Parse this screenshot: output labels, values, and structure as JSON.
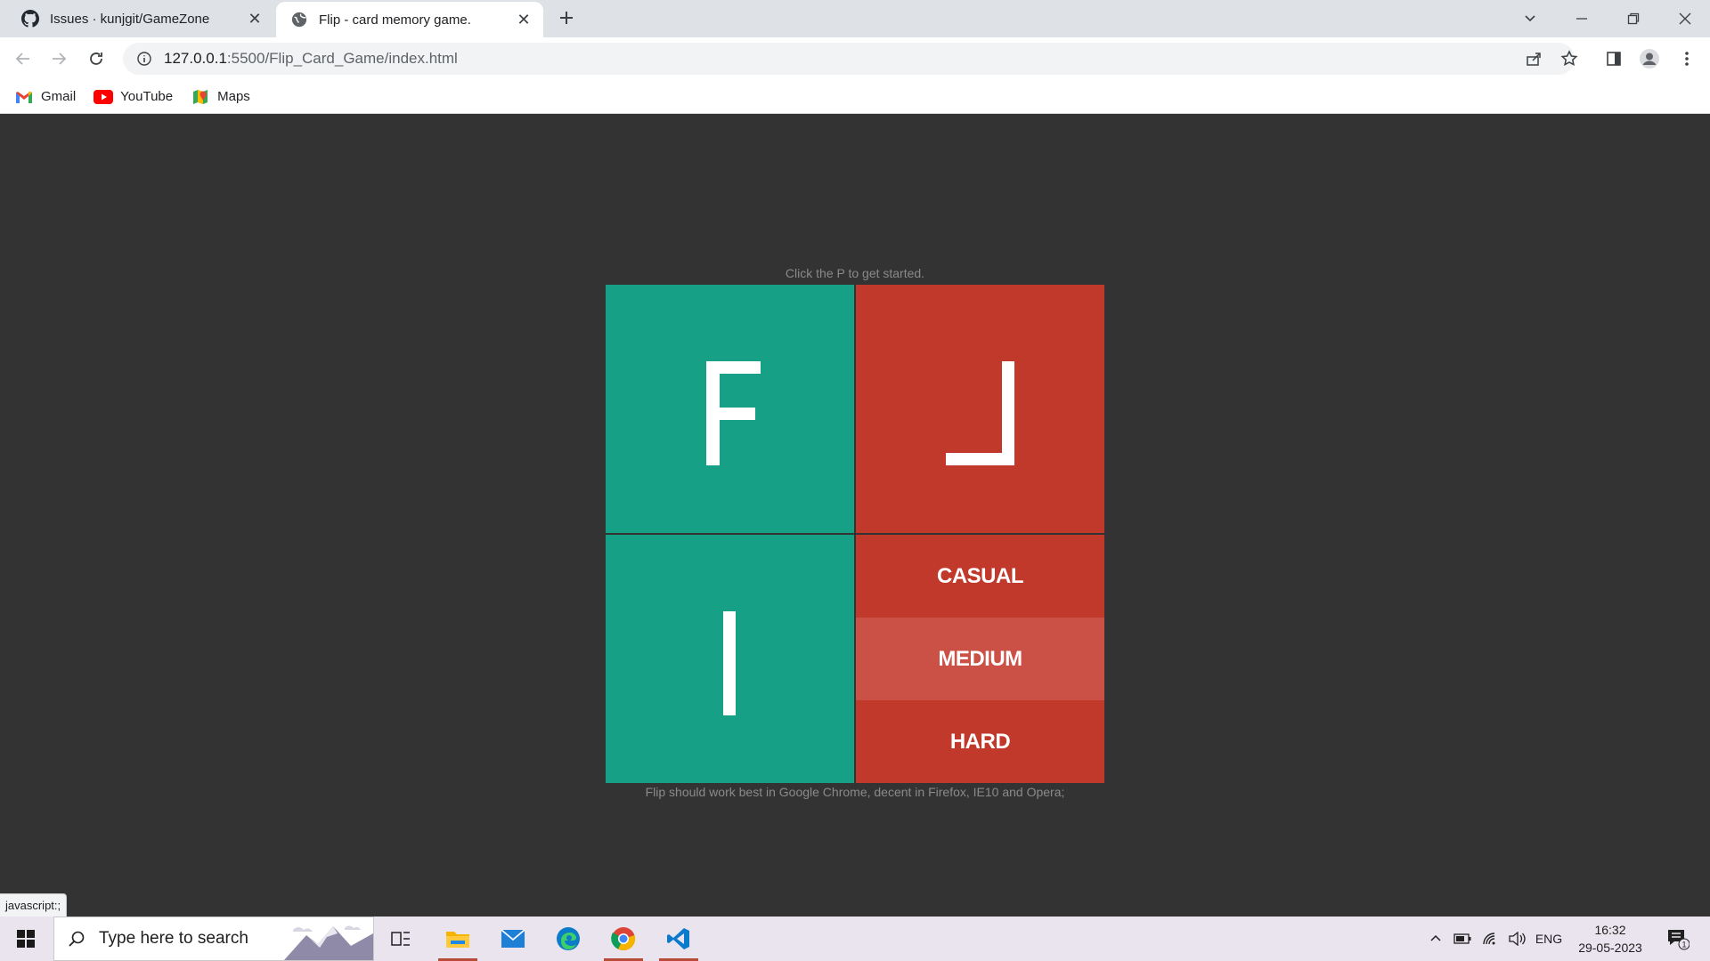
{
  "browser": {
    "tabs": [
      {
        "title": "Issues · kunjgit/GameZone",
        "icon": "github-icon",
        "active": false
      },
      {
        "title": "Flip - card memory game.",
        "icon": "globe-icon",
        "active": true
      }
    ],
    "url": {
      "host": "127.0.0.1",
      "path": ":5500/Flip_Card_Game/index.html"
    },
    "bookmarks": [
      {
        "label": "Gmail",
        "icon": "gmail-icon"
      },
      {
        "label": "YouTube",
        "icon": "youtube-icon"
      },
      {
        "label": "Maps",
        "icon": "maps-icon"
      }
    ],
    "status_url": "javascript:;"
  },
  "game": {
    "hint_top": "Click the P to get started.",
    "tiles": [
      {
        "letter": "F",
        "color": "#16a085"
      },
      {
        "letter": "L",
        "color": "#c0392b",
        "rotated": true
      },
      {
        "letter": "I",
        "color": "#16a085"
      }
    ],
    "difficulty": [
      "CASUAL",
      "MEDIUM",
      "HARD"
    ],
    "hint_bottom": "Flip should work best in Google Chrome, decent in Firefox, IE10 and Opera;"
  },
  "taskbar": {
    "search_placeholder": "Type here to search",
    "language": "ENG",
    "time": "16:32",
    "date": "29-05-2023",
    "notification_count": "1"
  },
  "colors": {
    "background": "#333333",
    "green": "#16a085",
    "red": "#c0392b",
    "red_hover": "#cb5045"
  }
}
